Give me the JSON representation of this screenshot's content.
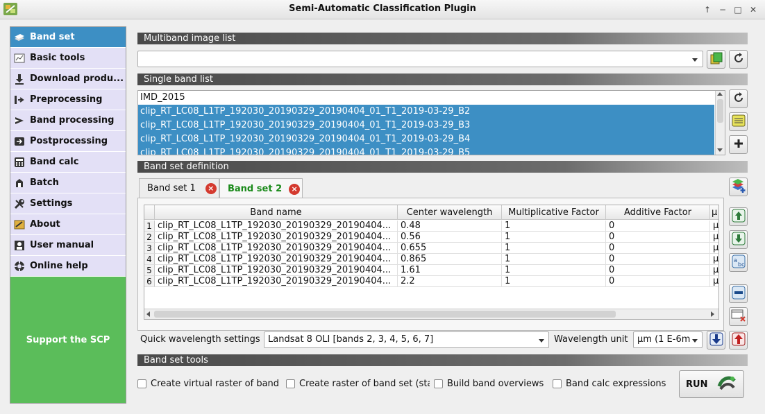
{
  "window": {
    "title": "Semi-Automatic Classification Plugin",
    "controls": [
      "↑",
      "−",
      "□",
      "✕"
    ]
  },
  "sidebar": {
    "items": [
      {
        "label": "Band set",
        "icon": "band-set-icon",
        "active": true
      },
      {
        "label": "Basic tools",
        "icon": "basic-tools-icon"
      },
      {
        "label": "Download produ...",
        "icon": "download-icon"
      },
      {
        "label": "Preprocessing",
        "icon": "preprocessing-icon"
      },
      {
        "label": "Band processing",
        "icon": "band-processing-icon"
      },
      {
        "label": "Postprocessing",
        "icon": "postprocessing-icon"
      },
      {
        "label": "Band calc",
        "icon": "calculator-icon"
      },
      {
        "label": "Batch",
        "icon": "batch-icon"
      },
      {
        "label": "Settings",
        "icon": "wrench-icon"
      },
      {
        "label": "About",
        "icon": "about-icon"
      },
      {
        "label": "User manual",
        "icon": "user-manual-icon"
      },
      {
        "label": "Online help",
        "icon": "online-help-icon"
      }
    ],
    "support": "Support the SCP"
  },
  "multiband": {
    "header": "Multiband image list",
    "value": ""
  },
  "single_band": {
    "header": "Single band list",
    "items": [
      {
        "label": "IMD_2015",
        "selected": false
      },
      {
        "label": "clip_RT_LC08_L1TP_192030_20190329_20190404_01_T1_2019-03-29_B2",
        "selected": true
      },
      {
        "label": "clip_RT_LC08_L1TP_192030_20190329_20190404_01_T1_2019-03-29_B3",
        "selected": true
      },
      {
        "label": "clip_RT_LC08_L1TP_192030_20190329_20190404_01_T1_2019-03-29_B4",
        "selected": true
      },
      {
        "label": "clip_RT_LC08_L1TP_192030_20190329_20190404_01_T1_2019-03-29_B5",
        "selected": true
      }
    ]
  },
  "definition": {
    "header": "Band set definition",
    "tabs": [
      {
        "label": "Band set 1",
        "active": false
      },
      {
        "label": "Band set 2",
        "active": true
      }
    ],
    "columns": [
      "Band name",
      "Center wavelength",
      "Multiplicative Factor",
      "Additive Factor",
      "µ"
    ],
    "rows": [
      {
        "num": "1",
        "name": "clip_RT_LC08_L1TP_192030_20190329_20190404...",
        "center": "0.48",
        "mult": "1",
        "add": "0",
        "unit": "µ"
      },
      {
        "num": "2",
        "name": "clip_RT_LC08_L1TP_192030_20190329_20190404...",
        "center": "0.56",
        "mult": "1",
        "add": "0",
        "unit": "µ"
      },
      {
        "num": "3",
        "name": "clip_RT_LC08_L1TP_192030_20190329_20190404...",
        "center": "0.655",
        "mult": "1",
        "add": "0",
        "unit": "µ"
      },
      {
        "num": "4",
        "name": "clip_RT_LC08_L1TP_192030_20190329_20190404...",
        "center": "0.865",
        "mult": "1",
        "add": "0",
        "unit": "µ"
      },
      {
        "num": "5",
        "name": "clip_RT_LC08_L1TP_192030_20190329_20190404...",
        "center": "1.61",
        "mult": "1",
        "add": "0",
        "unit": "µ"
      },
      {
        "num": "6",
        "name": "clip_RT_LC08_L1TP_192030_20190329_20190404...",
        "center": "2.2",
        "mult": "1",
        "add": "0",
        "unit": "µ"
      }
    ],
    "quick_label": "Quick wavelength settings",
    "quick_value": "Landsat 8 OLI [bands 2, 3, 4, 5, 6, 7]",
    "unit_label": "Wavelength unit",
    "unit_value": "µm (1 E-6m"
  },
  "tools": {
    "header": "Band set tools",
    "checkboxes": [
      {
        "label": "Create virtual raster of band",
        "checked": false
      },
      {
        "label": "Create raster of band set (sta",
        "checked": false
      },
      {
        "label": "Build band overviews",
        "checked": false
      },
      {
        "label": "Band calc expressions",
        "checked": false
      }
    ],
    "run": "RUN"
  },
  "colors": {
    "accent": "#3d8fc4",
    "sidebar_bg": "#e3e0f6",
    "support_bg": "#5bbd5a",
    "active_tab": "#1a8a1a",
    "close_red": "#d43a2f"
  }
}
